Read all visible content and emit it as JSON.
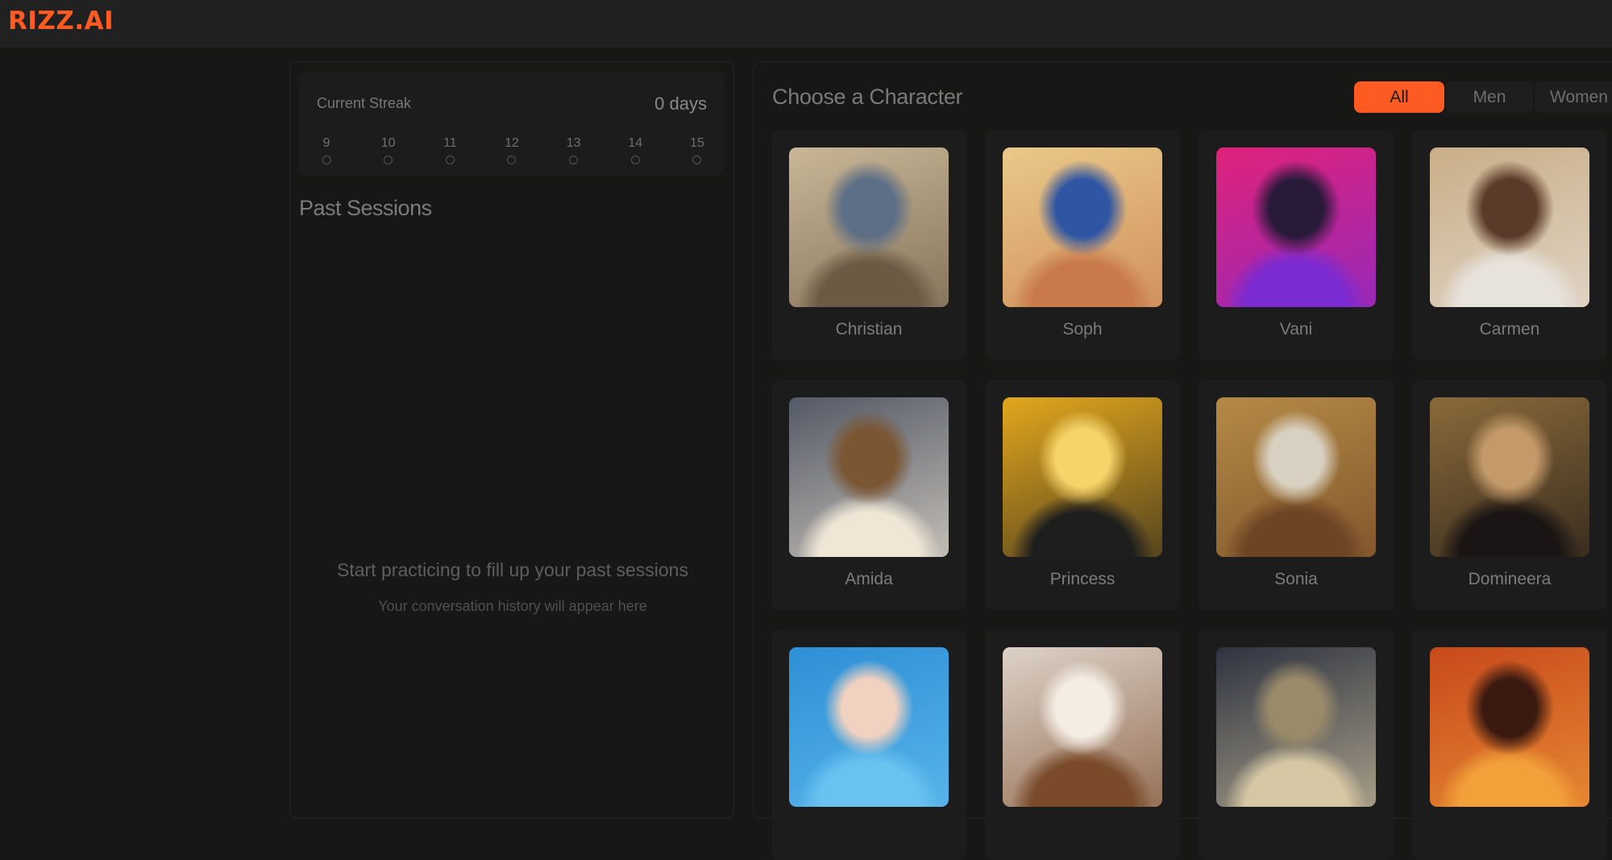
{
  "header": {
    "logo_text": "RIZZ.AI",
    "brand_color": "#fe5b22"
  },
  "streak": {
    "label": "Current Streak",
    "value": "0 days",
    "days": [
      "9",
      "10",
      "11",
      "12",
      "13",
      "14",
      "15"
    ]
  },
  "past_sessions": {
    "title": "Past Sessions",
    "empty_title": "Start practicing to fill up your past sessions",
    "empty_subtitle": "Your conversation history will appear here"
  },
  "characters": {
    "title": "Choose a Character",
    "filters": [
      {
        "label": "All",
        "active": true
      },
      {
        "label": "Men",
        "active": false
      },
      {
        "label": "Women",
        "active": false
      }
    ],
    "items": [
      {
        "name": "Christian",
        "palette": [
          "#c9b797",
          "#6d5a45",
          "#5c6f86"
        ]
      },
      {
        "name": "Soph",
        "palette": [
          "#e9c98a",
          "#c97a4b",
          "#2f56a3"
        ]
      },
      {
        "name": "Vani",
        "palette": [
          "#e0227a",
          "#7a2bd1",
          "#2a1a3a"
        ]
      },
      {
        "name": "Carmen",
        "palette": [
          "#c9ae87",
          "#e8e2dc",
          "#5a3a28"
        ]
      },
      {
        "name": "Amida",
        "palette": [
          "#545966",
          "#efe6d6",
          "#7a5632"
        ]
      },
      {
        "name": "Princess",
        "palette": [
          "#e3a71d",
          "#1e1e1e",
          "#f6d46a"
        ]
      },
      {
        "name": "Sonia",
        "palette": [
          "#b58a45",
          "#6d4424",
          "#d8d0c0"
        ]
      },
      {
        "name": "Domineera",
        "palette": [
          "#8a6a3a",
          "#1a1514",
          "#c59a6a"
        ]
      },
      {
        "name": "",
        "palette": [
          "#2d8fd6",
          "#69c2f0",
          "#f1d2c0"
        ]
      },
      {
        "name": "",
        "palette": [
          "#ddd2c8",
          "#7a4a2a",
          "#f4ede4"
        ]
      },
      {
        "name": "",
        "palette": [
          "#2e3340",
          "#d6c7a4",
          "#9a8a6a"
        ]
      },
      {
        "name": "",
        "palette": [
          "#c7491c",
          "#f2a03a",
          "#3a1a10"
        ]
      }
    ]
  }
}
